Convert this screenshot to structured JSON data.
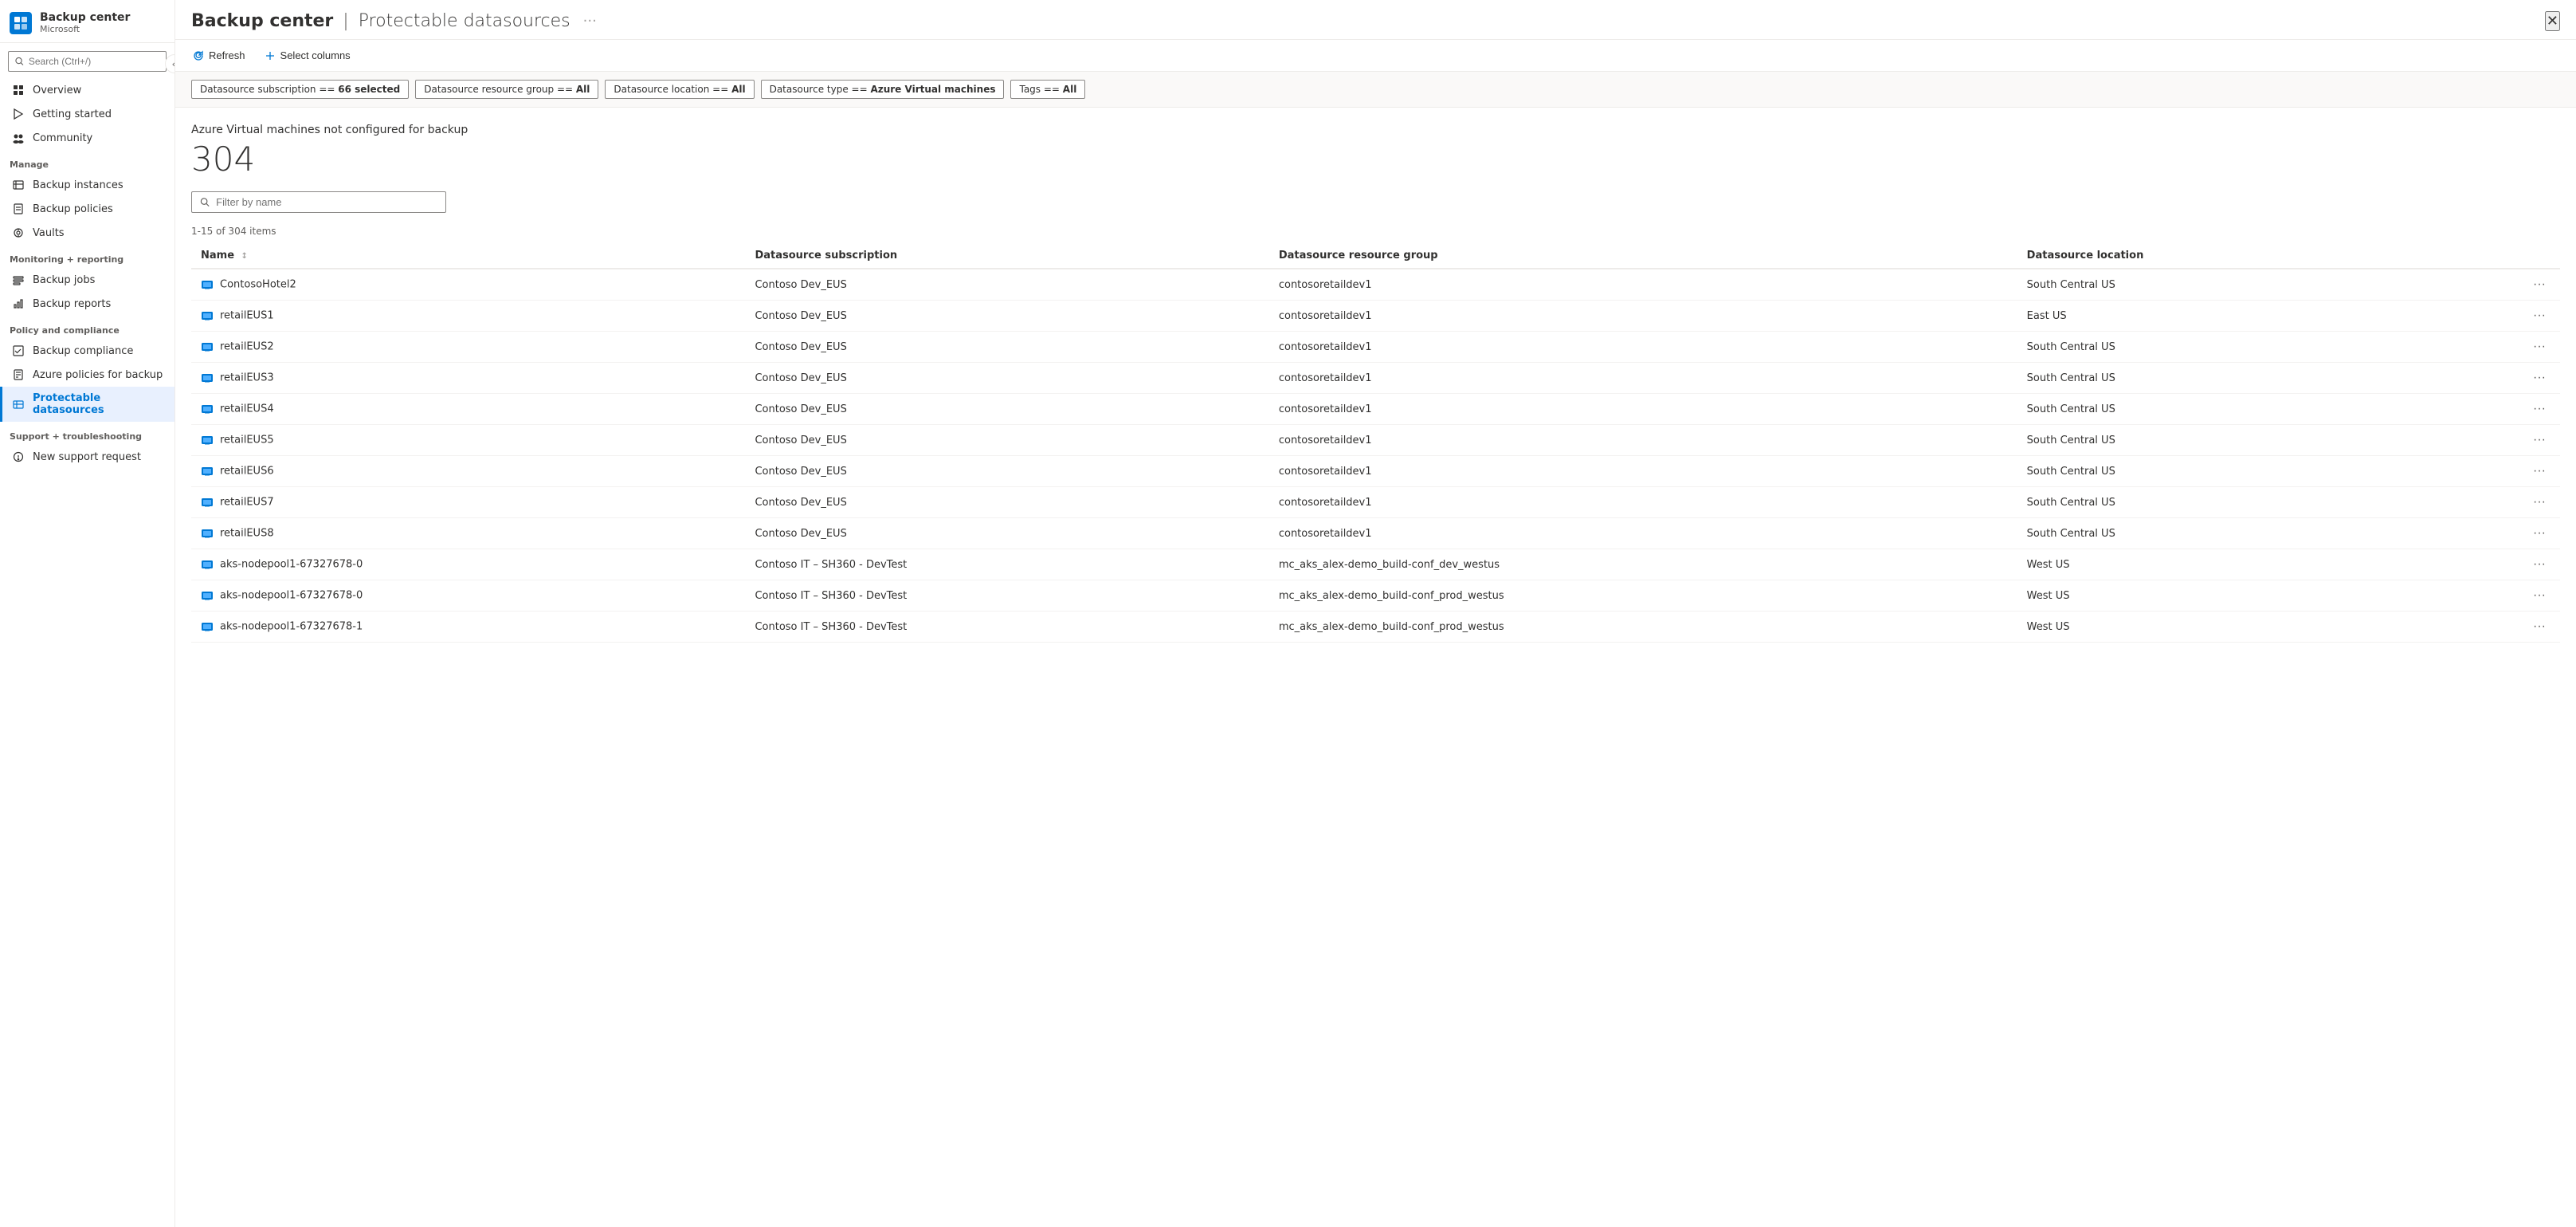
{
  "app": {
    "title": "Backup center",
    "separator": "|",
    "subtitle": "Protectable datasources",
    "provider": "Microsoft",
    "close_label": "×",
    "more_options_label": "···"
  },
  "search": {
    "placeholder": "Search (Ctrl+/)"
  },
  "toolbar": {
    "refresh_label": "Refresh",
    "select_columns_label": "Select columns"
  },
  "filters": [
    {
      "label": "Datasource subscription == 66 selected"
    },
    {
      "label": "Datasource resource group == All"
    },
    {
      "label": "Datasource location == All"
    },
    {
      "label": "Datasource type == Azure Virtual machines"
    },
    {
      "label": "Tags == All"
    }
  ],
  "summary": {
    "title": "Azure Virtual machines not configured for backup",
    "count": "304"
  },
  "table_filter": {
    "placeholder": "Filter by name"
  },
  "items_range": "1-15 of 304 items",
  "columns": [
    {
      "key": "name",
      "label": "Name",
      "sortable": true
    },
    {
      "key": "subscription",
      "label": "Datasource subscription",
      "sortable": false
    },
    {
      "key": "resource_group",
      "label": "Datasource resource group",
      "sortable": false
    },
    {
      "key": "location",
      "label": "Datasource location",
      "sortable": false
    }
  ],
  "rows": [
    {
      "name": "ContosoHotel2",
      "subscription": "Contoso Dev_EUS",
      "resource_group": "contosoretaildev1",
      "location": "South Central US"
    },
    {
      "name": "retailEUS1",
      "subscription": "Contoso Dev_EUS",
      "resource_group": "contosoretaildev1",
      "location": "East US"
    },
    {
      "name": "retailEUS2",
      "subscription": "Contoso Dev_EUS",
      "resource_group": "contosoretaildev1",
      "location": "South Central US"
    },
    {
      "name": "retailEUS3",
      "subscription": "Contoso Dev_EUS",
      "resource_group": "contosoretaildev1",
      "location": "South Central US"
    },
    {
      "name": "retailEUS4",
      "subscription": "Contoso Dev_EUS",
      "resource_group": "contosoretaildev1",
      "location": "South Central US"
    },
    {
      "name": "retailEUS5",
      "subscription": "Contoso Dev_EUS",
      "resource_group": "contosoretaildev1",
      "location": "South Central US"
    },
    {
      "name": "retailEUS6",
      "subscription": "Contoso Dev_EUS",
      "resource_group": "contosoretaildev1",
      "location": "South Central US"
    },
    {
      "name": "retailEUS7",
      "subscription": "Contoso Dev_EUS",
      "resource_group": "contosoretaildev1",
      "location": "South Central US"
    },
    {
      "name": "retailEUS8",
      "subscription": "Contoso Dev_EUS",
      "resource_group": "contosoretaildev1",
      "location": "South Central US"
    },
    {
      "name": "aks-nodepool1-67327678-0",
      "subscription": "Contoso IT – SH360 - DevTest",
      "resource_group": "mc_aks_alex-demo_build-conf_dev_westus",
      "location": "West US"
    },
    {
      "name": "aks-nodepool1-67327678-0",
      "subscription": "Contoso IT – SH360 - DevTest",
      "resource_group": "mc_aks_alex-demo_build-conf_prod_westus",
      "location": "West US"
    },
    {
      "name": "aks-nodepool1-67327678-1",
      "subscription": "Contoso IT – SH360 - DevTest",
      "resource_group": "mc_aks_alex-demo_build-conf_prod_westus",
      "location": "West US"
    }
  ],
  "sidebar": {
    "nav_items": [
      {
        "id": "overview",
        "label": "Overview",
        "icon": "grid-icon",
        "section": null
      },
      {
        "id": "getting-started",
        "label": "Getting started",
        "icon": "rocket-icon",
        "section": null
      },
      {
        "id": "community",
        "label": "Community",
        "icon": "community-icon",
        "section": null
      },
      {
        "id": "manage-header",
        "label": "Manage",
        "is_section": true
      },
      {
        "id": "backup-instances",
        "label": "Backup instances",
        "icon": "backup-instances-icon",
        "section": "Manage"
      },
      {
        "id": "backup-policies",
        "label": "Backup policies",
        "icon": "backup-policies-icon",
        "section": "Manage"
      },
      {
        "id": "vaults",
        "label": "Vaults",
        "icon": "vaults-icon",
        "section": "Manage"
      },
      {
        "id": "monitoring-header",
        "label": "Monitoring + reporting",
        "is_section": true
      },
      {
        "id": "backup-jobs",
        "label": "Backup jobs",
        "icon": "backup-jobs-icon",
        "section": "Monitoring + reporting"
      },
      {
        "id": "backup-reports",
        "label": "Backup reports",
        "icon": "backup-reports-icon",
        "section": "Monitoring + reporting"
      },
      {
        "id": "policy-header",
        "label": "Policy and compliance",
        "is_section": true
      },
      {
        "id": "backup-compliance",
        "label": "Backup compliance",
        "icon": "backup-compliance-icon",
        "section": "Policy and compliance"
      },
      {
        "id": "azure-policies",
        "label": "Azure policies for backup",
        "icon": "azure-policies-icon",
        "section": "Policy and compliance"
      },
      {
        "id": "protectable-datasources",
        "label": "Protectable datasources",
        "icon": "protectable-icon",
        "section": "Policy and compliance",
        "active": true
      },
      {
        "id": "support-header",
        "label": "Support + troubleshooting",
        "is_section": true
      },
      {
        "id": "new-support-request",
        "label": "New support request",
        "icon": "support-icon",
        "section": "Support + troubleshooting"
      }
    ]
  }
}
